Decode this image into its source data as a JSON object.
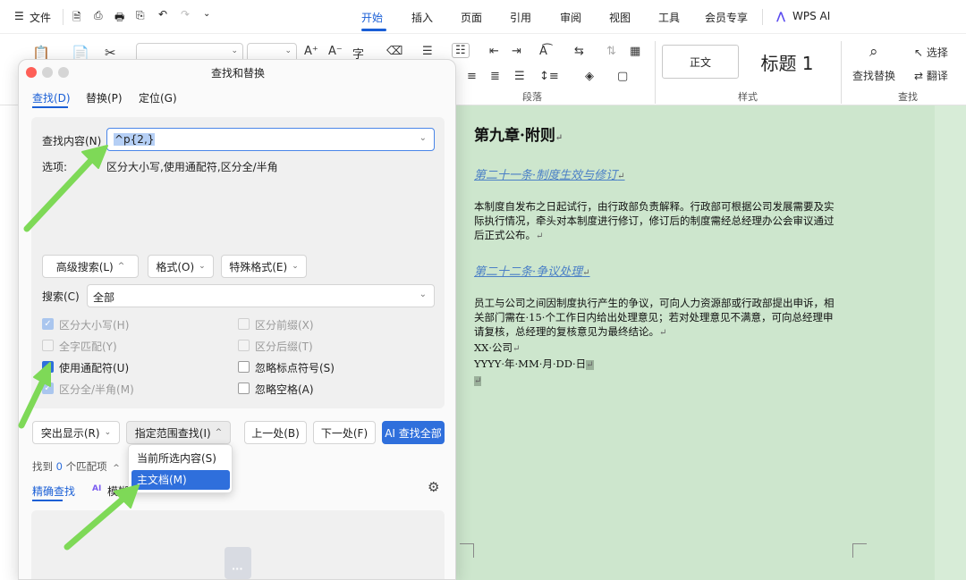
{
  "menubar": {
    "file_menu": "文件",
    "tabs": [
      "开始",
      "插入",
      "页面",
      "引用",
      "审阅",
      "视图",
      "工具",
      "会员专享"
    ],
    "ai_label": "WPS AI"
  },
  "ribbon": {
    "paragraph_label": "段落",
    "styles_label": "样式",
    "find_label": "查找",
    "style_normal": "正文",
    "style_heading1": "标题 1",
    "find_replace": "查找替换",
    "select": "选择",
    "translate": "翻译"
  },
  "dialog": {
    "title": "查找和替换",
    "tabs": [
      "查找(D)",
      "替换(P)",
      "定位(G)"
    ],
    "find_label": "查找内容(N)",
    "find_value": "^p{2,}",
    "options_label": "选项:",
    "options_value": "区分大小写,使用通配符,区分全/半角",
    "advanced_btn": "高级搜索(L)",
    "format_btn": "格式(O)",
    "special_btn": "特殊格式(E)",
    "search_label": "搜索(C)",
    "search_value": "全部",
    "checks": {
      "match_case": "区分大小写(H)",
      "whole_word": "全字匹配(Y)",
      "wildcards": "使用通配符(U)",
      "full_half": "区分全/半角(M)",
      "prefix": "区分前缀(X)",
      "suffix": "区分后缀(T)",
      "ignore_punct": "忽略标点符号(S)",
      "ignore_space": "忽略空格(A)"
    },
    "highlight_btn": "突出显示(R)",
    "range_btn": "指定范围查找(I)",
    "prev_btn": "上一处(B)",
    "next_btn": "下一处(F)",
    "find_all_btn": "AI 查找全部",
    "found_prefix": "找到",
    "found_count": "0",
    "found_suffix": "个匹配项",
    "precise_tab": "精确查找",
    "fuzzy_tab": "模糊"
  },
  "range_menu": {
    "items": [
      "当前所选内容(S)",
      "主文档(M)"
    ]
  },
  "document": {
    "chapter_title": "第九章·附则",
    "article21": "第二十一条·制度生效与修订",
    "para21": [
      "本制度自发布之日起试行，由行政部负责解释。行政部可根据公司发展需要及实",
      "际执行情况，牵头对本制度进行修订，修订后的制度需经总经理办公会审议通过",
      "后正式公布。"
    ],
    "article22": "第二十二条·争议处理",
    "para22": [
      "员工与公司之间因制度执行产生的争议，可向人力资源部或行政部提出申诉，相",
      "关部门需在·15·个工作日内给出处理意见；若对处理意见不满意，可向总经理申",
      "请复核，总经理的复核意见为最终结论。"
    ],
    "company": "XX·公司",
    "date": "YYYY·年·MM·月·DD·日"
  }
}
